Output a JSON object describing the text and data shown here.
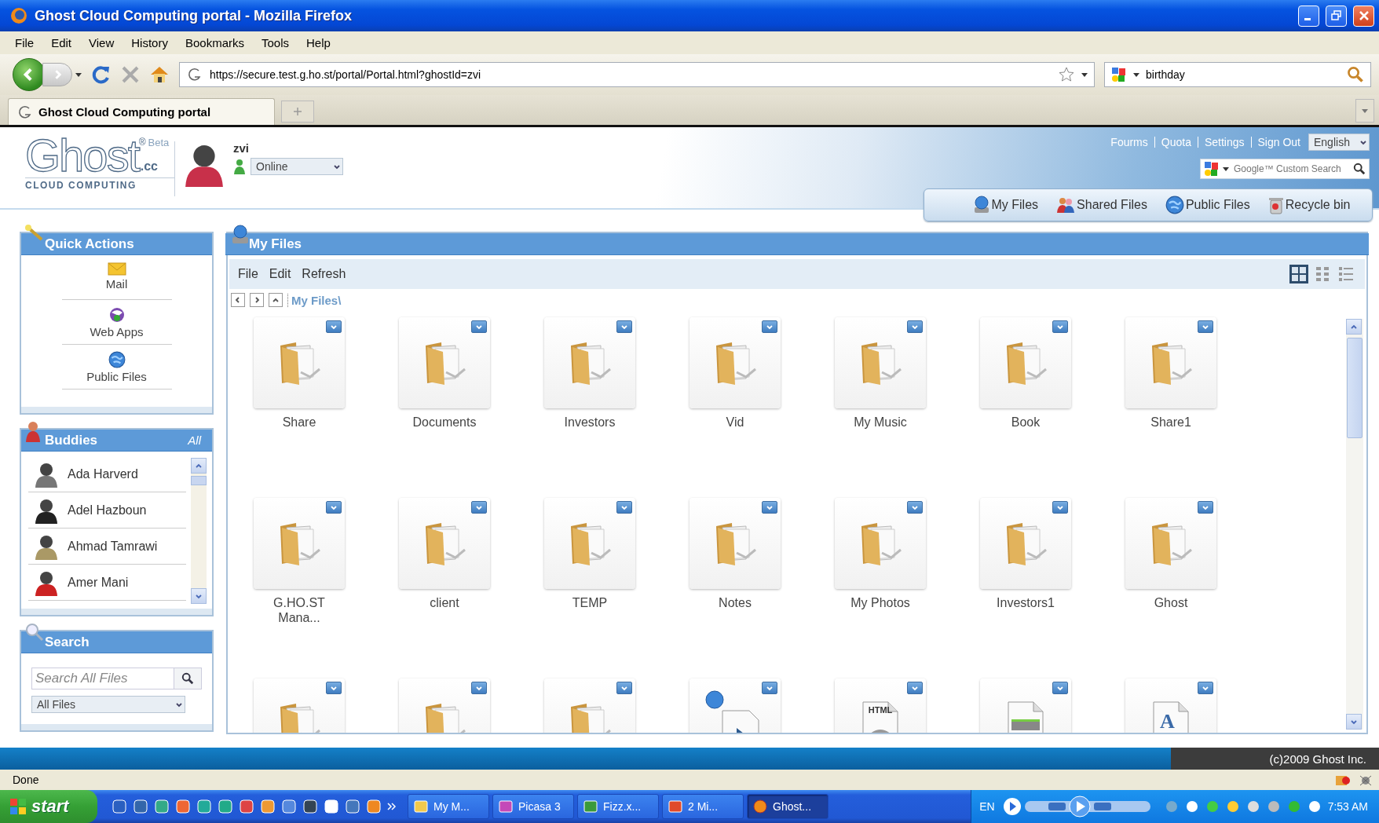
{
  "window": {
    "title": "Ghost Cloud Computing portal - Mozilla Firefox"
  },
  "menu": [
    "File",
    "Edit",
    "View",
    "History",
    "Bookmarks",
    "Tools",
    "Help"
  ],
  "address_bar": {
    "url": "https://secure.test.g.ho.st/portal/Portal.html?ghostId=zvi"
  },
  "search_bar": {
    "value": "birthday"
  },
  "tabs": [
    {
      "label": "Ghost Cloud Computing portal",
      "selected": true
    }
  ],
  "header": {
    "logo": {
      "name": "Ghost",
      "mark": "®",
      "badge": "Beta",
      "suffix": ".cc",
      "tagline": "CLOUD COMPUTING"
    },
    "user": {
      "name": "zvi",
      "status": "Online"
    },
    "links": [
      "Fourms",
      "Quota",
      "Settings",
      "Sign Out"
    ],
    "language": "English",
    "search": {
      "placeholder": "Google™ Custom Search"
    },
    "nav": [
      {
        "label": "My Files",
        "kind": "drive"
      },
      {
        "label": "Shared Files",
        "kind": "people"
      },
      {
        "label": "Public Files",
        "kind": "globe"
      },
      {
        "label": "Recycle bin",
        "kind": "bin"
      }
    ]
  },
  "quick_actions": {
    "title": "Quick Actions",
    "items": [
      {
        "label": "Mail",
        "kind": "mail"
      },
      {
        "label": "Web Apps",
        "kind": "apps"
      },
      {
        "label": "Public Files",
        "kind": "globe"
      }
    ]
  },
  "buddies": {
    "title": "Buddies",
    "filter": "All",
    "items": [
      {
        "name": "Ada Harverd"
      },
      {
        "name": "Adel Hazboun"
      },
      {
        "name": "Ahmad Tamrawi"
      },
      {
        "name": "Amer Mani"
      }
    ]
  },
  "search_panel": {
    "title": "Search",
    "placeholder": "Search All Files",
    "scope": "All Files"
  },
  "files_panel": {
    "title": "My Files",
    "menu": [
      "File",
      "Edit",
      "Refresh"
    ],
    "views": [
      {
        "kind": "thumbnails",
        "selected": true
      },
      {
        "kind": "tiles",
        "selected": false
      },
      {
        "kind": "list",
        "selected": false
      }
    ],
    "path": "My Files\\",
    "items": [
      {
        "name": "Share",
        "kind": "folder"
      },
      {
        "name": "Documents",
        "kind": "folder"
      },
      {
        "name": "Investors",
        "kind": "folder"
      },
      {
        "name": "Vid",
        "kind": "folder"
      },
      {
        "name": "My Music",
        "kind": "folder"
      },
      {
        "name": "Book",
        "kind": "folder"
      },
      {
        "name": "Share1",
        "kind": "folder"
      },
      {
        "name": "G.HO.ST Mana...",
        "kind": "folder"
      },
      {
        "name": "client",
        "kind": "folder"
      },
      {
        "name": "TEMP",
        "kind": "folder"
      },
      {
        "name": "Notes",
        "kind": "folder"
      },
      {
        "name": "My Photos",
        "kind": "folder"
      },
      {
        "name": "Investors1",
        "kind": "folder"
      },
      {
        "name": "Ghost",
        "kind": "folder"
      },
      {
        "kind": "folder"
      },
      {
        "kind": "folder"
      },
      {
        "kind": "folder"
      },
      {
        "kind": "web"
      },
      {
        "kind": "html",
        "badge": "HTML"
      },
      {
        "kind": "drive"
      },
      {
        "kind": "text",
        "badge": "A"
      }
    ]
  },
  "footer": {
    "copyright": "(c)2009 Ghost Inc."
  },
  "status_bar": {
    "text": "Done"
  },
  "taskbar": {
    "start": "start",
    "tasks": [
      {
        "label": "My M...",
        "kind": "folder",
        "selected": false
      },
      {
        "label": "Picasa 3",
        "kind": "picasa",
        "selected": false
      },
      {
        "label": "Fizz.x...",
        "kind": "sheet",
        "selected": false
      },
      {
        "label": "2 Mi...",
        "kind": "mail",
        "selected": false
      },
      {
        "label": "Ghost...",
        "kind": "browser",
        "selected": true
      }
    ],
    "language": "EN",
    "clock": "7:53 AM"
  }
}
